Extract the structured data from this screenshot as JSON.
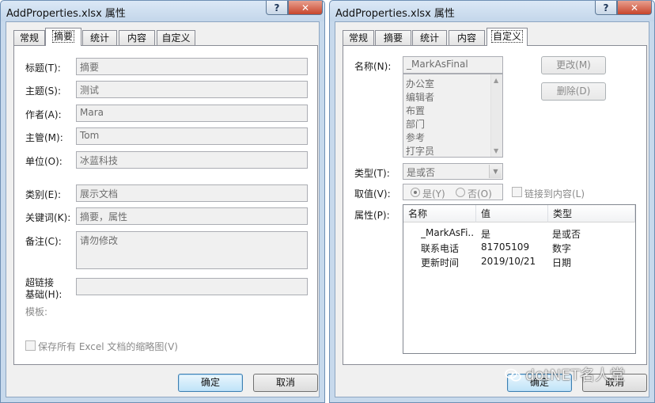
{
  "summary_dialog": {
    "title": "AddProperties.xlsx 属性",
    "help_glyph": "?",
    "close_glyph": "✕",
    "tabs": [
      "常规",
      "摘要",
      "统计",
      "内容",
      "自定义"
    ],
    "active_tab": "摘要",
    "fields": {
      "title": {
        "label": "标题(T):",
        "value": "摘要"
      },
      "subject": {
        "label": "主题(S):",
        "value": "测试"
      },
      "author": {
        "label": "作者(A):",
        "value": "Mara"
      },
      "manager": {
        "label": "主管(M):",
        "value": "Tom"
      },
      "company": {
        "label": "单位(O):",
        "value": "冰蓝科技"
      },
      "category": {
        "label": "类别(E):",
        "value": "展示文档"
      },
      "keywords": {
        "label": "关键词(K):",
        "value": "摘要，属性"
      },
      "comments": {
        "label": "备注(C):",
        "value": "请勿修改"
      },
      "hyperlink_base": {
        "label_line1": "超链接",
        "label_line2": "基础(H):",
        "value": ""
      }
    },
    "template_label": "模板:",
    "thumbnail_checkbox_label": "保存所有 Excel 文档的缩略图(V)",
    "ok_label": "确定",
    "cancel_label": "取消"
  },
  "custom_dialog": {
    "title": "AddProperties.xlsx 属性",
    "help_glyph": "?",
    "close_glyph": "✕",
    "tabs": [
      "常规",
      "摘要",
      "统计",
      "内容",
      "自定义"
    ],
    "active_tab": "自定义",
    "name_label": "名称(N):",
    "name_value": "_MarkAsFinal",
    "name_options": [
      "办公室",
      "编辑者",
      "布置",
      "部门",
      "参考",
      "打字员"
    ],
    "modify_label": "更改(M)",
    "delete_label": "删除(D)",
    "type_label": "类型(T):",
    "type_value": "是或否",
    "value_label": "取值(V):",
    "radio_yes_label": "是(Y)",
    "radio_no_label": "否(O)",
    "link_checkbox_label": "链接到内容(L)",
    "properties_label": "属性(P):",
    "columns": [
      "名称",
      "值",
      "类型"
    ],
    "rows": [
      {
        "name": "_MarkAsFi...",
        "value": "是",
        "type": "是或否"
      },
      {
        "name": "联系电话",
        "value": "81705109",
        "type": "数字"
      },
      {
        "name": "更新时间",
        "value": "2019/10/21",
        "type": "日期"
      }
    ],
    "ok_label": "确定",
    "cancel_label": "取消"
  },
  "watermark_text": "dotNET名人堂"
}
